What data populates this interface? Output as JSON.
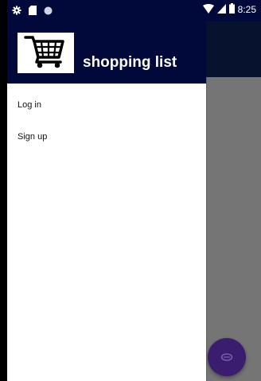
{
  "status_bar": {
    "time": "8:25",
    "icons_left": [
      "settings-icon",
      "sd-card-icon",
      "circle-icon"
    ],
    "icons_right": [
      "wifi-icon",
      "cellular-icon",
      "battery-icon"
    ]
  },
  "drawer": {
    "title": "shopping list",
    "logo_icon": "shopping-cart-icon",
    "items": [
      {
        "label": "Log in"
      },
      {
        "label": "Sign up"
      }
    ]
  },
  "fab": {
    "icon": "fab-icon"
  },
  "colors": {
    "header_bg": "#00093a",
    "drawer_bg": "#ffffff",
    "scrim_bg": "#757575",
    "fab_bg": "#3a1d6e"
  }
}
